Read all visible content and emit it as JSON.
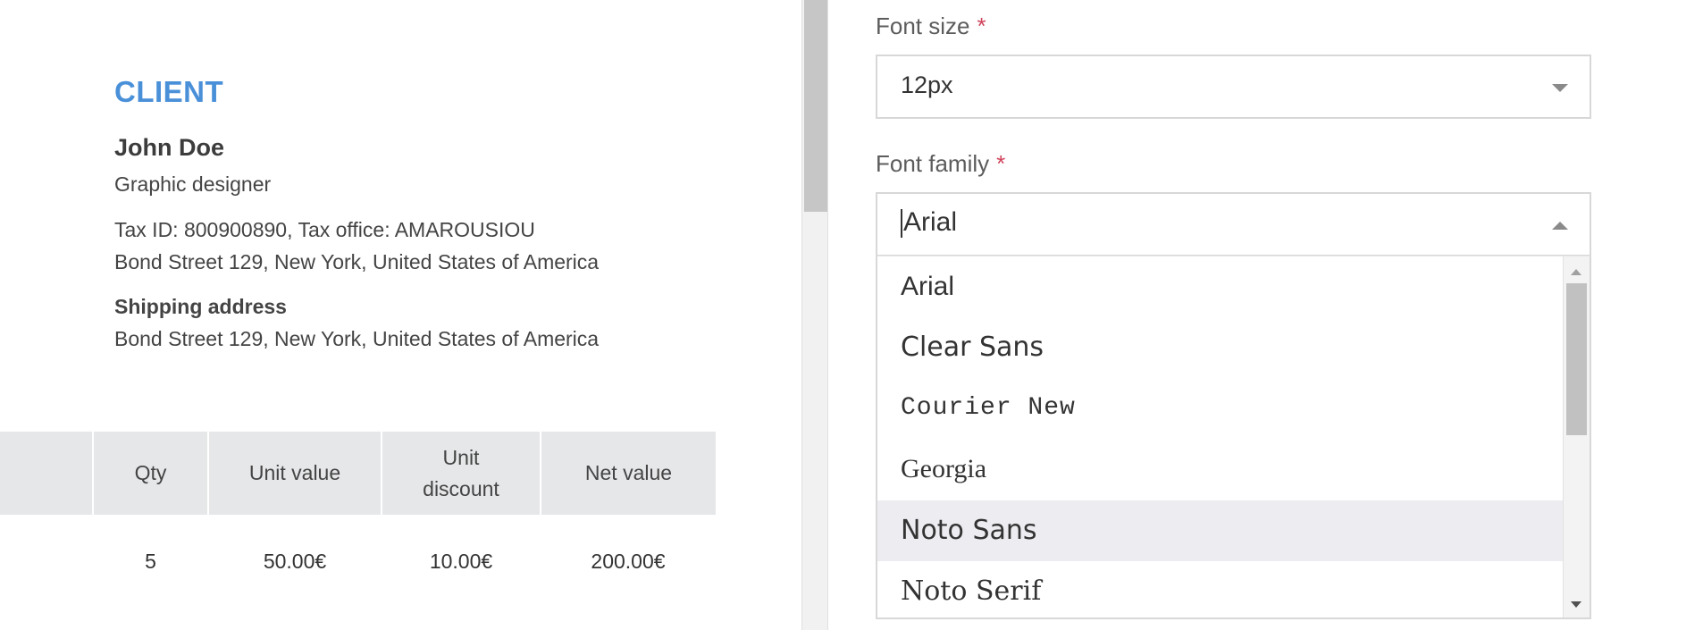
{
  "client": {
    "heading": "CLIENT",
    "name": "John Doe",
    "title": "Graphic designer",
    "tax_line": "Tax ID: 800900890, Tax office: AMAROUSIOU",
    "address": "Bond Street 129, New York, United States of America",
    "shipping_label": "Shipping address",
    "shipping_address": "Bond Street 129, New York, United States of America"
  },
  "table": {
    "headers": [
      "",
      "Qty",
      "Unit value",
      "Unit discount",
      "Net value"
    ],
    "header_unit_discount_line1": "Unit",
    "header_unit_discount_line2": "discount",
    "rows": [
      {
        "col0": "",
        "qty": "5",
        "unit_value": "50.00€",
        "unit_discount": "10.00€",
        "net_value": "200.00€"
      }
    ]
  },
  "settings": {
    "font_size": {
      "label": "Font size",
      "required_mark": "*",
      "value": "12px"
    },
    "font_family": {
      "label": "Font family",
      "required_mark": "*",
      "value": "Arial",
      "options": [
        "Arial",
        "Clear Sans",
        "Courier New",
        "Georgia",
        "Noto Sans",
        "Noto Serif"
      ],
      "highlighted_option": "Noto Sans"
    }
  },
  "colors": {
    "accent": "#4a90d9",
    "required": "#d0435b",
    "highlight": "#ededf1"
  },
  "icons": {
    "select_caret": "chevron-down-icon",
    "open_caret": "chevron-up-icon",
    "scroll_up": "scroll-up-arrow-icon",
    "scroll_down": "scroll-down-arrow-icon"
  }
}
